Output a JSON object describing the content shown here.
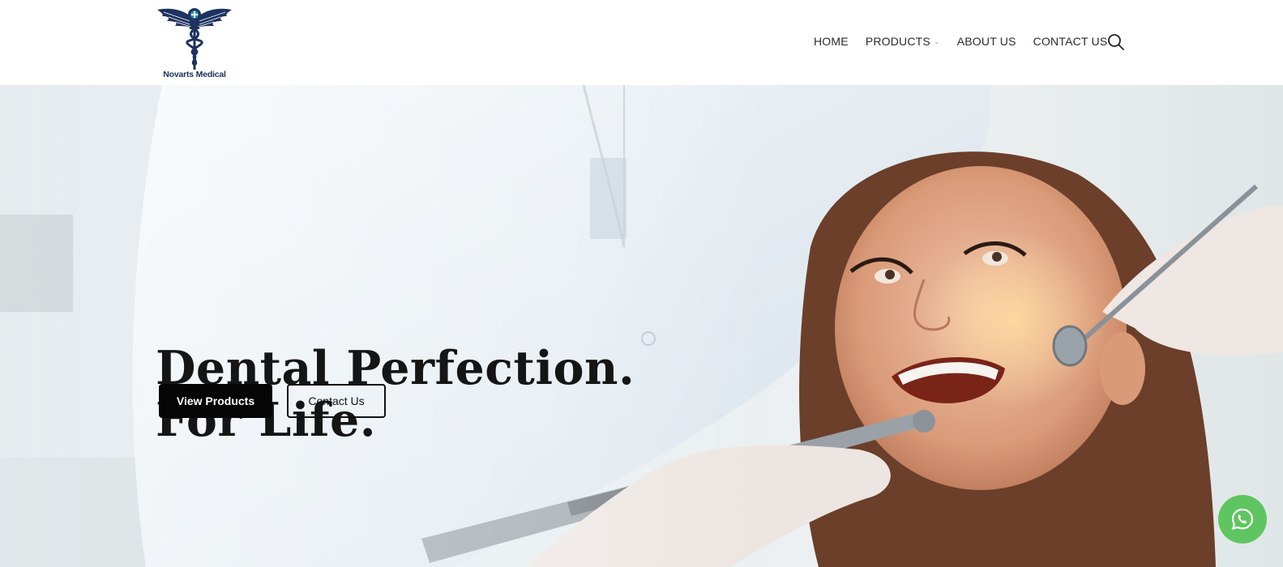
{
  "brand": {
    "name": "Novarts Medical",
    "logo_icon": "caduceus-icon"
  },
  "nav": {
    "items": [
      {
        "label": "HOME"
      },
      {
        "label": "PRODUCTS",
        "has_dropdown": true
      },
      {
        "label": "ABOUT US"
      },
      {
        "label": "CONTACT US"
      }
    ],
    "search_icon": "search-icon"
  },
  "hero": {
    "headline_line1": "Dental Perfection.",
    "headline_line2": "For Life.",
    "primary_button": "View Products",
    "secondary_button": "Contact Us",
    "image_subject": "dentist examining smiling patient"
  },
  "floating": {
    "icon": "whatsapp-icon",
    "color": "#5fc560"
  },
  "colors": {
    "brand_navy": "#1e3260",
    "button_dark": "#050505",
    "text_dark": "#151515"
  }
}
